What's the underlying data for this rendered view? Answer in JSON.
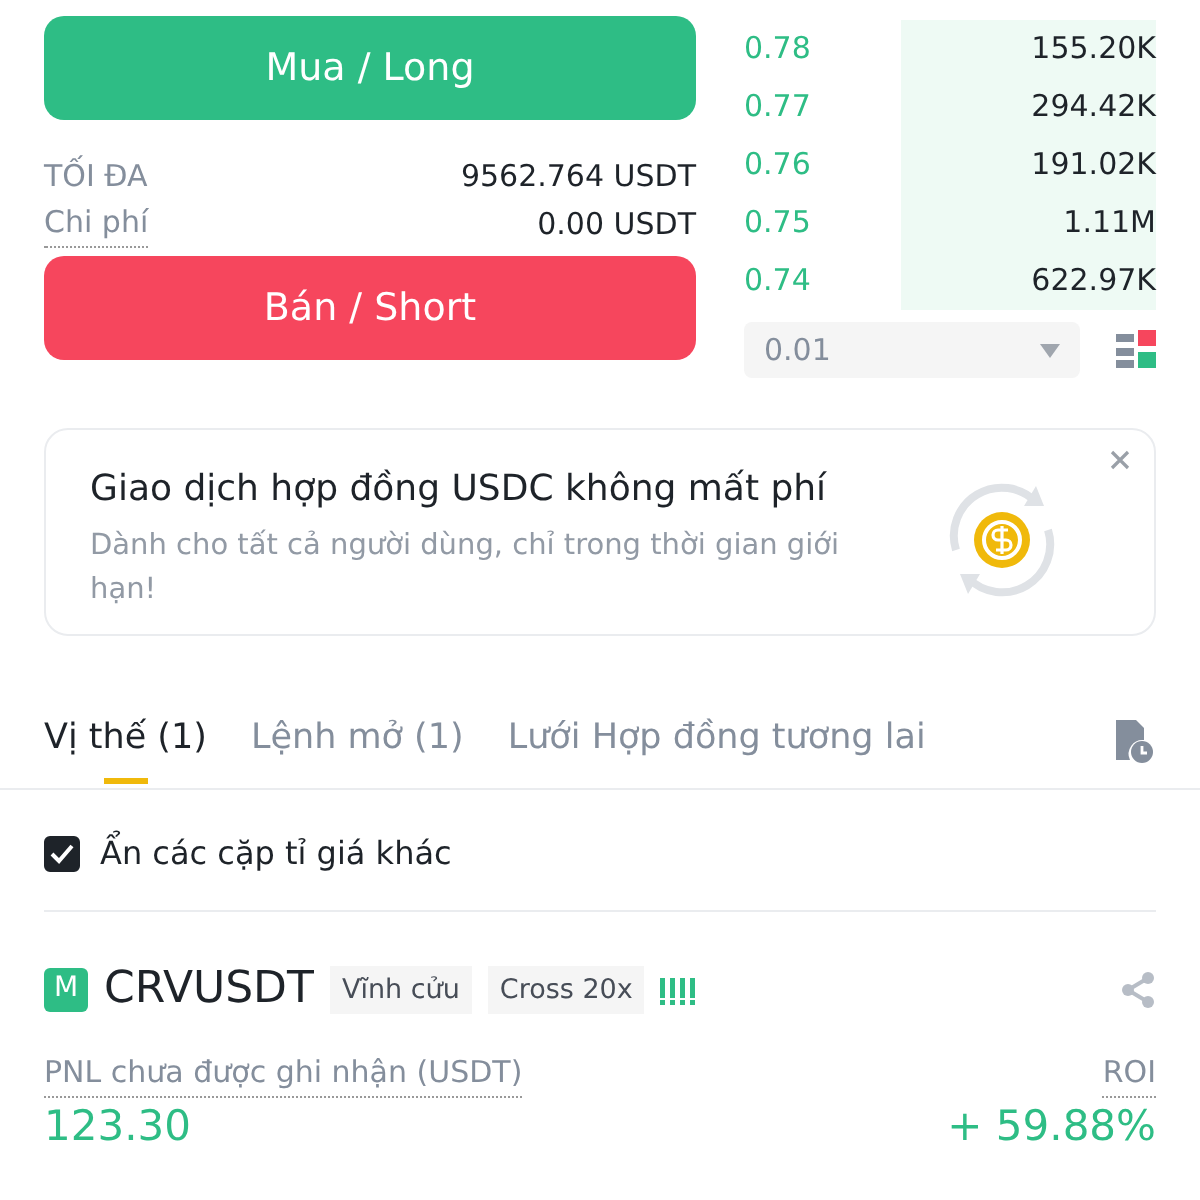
{
  "buy_button": "Mua / Long",
  "max_row": {
    "label": "TỐI ĐA",
    "value": "9562.764 USDT"
  },
  "cost_row": {
    "label": "Chi phí",
    "value": "0.00 USDT"
  },
  "sell_button": "Bán / Short",
  "order_book": [
    {
      "price": "0.78",
      "amount": "155.20K"
    },
    {
      "price": "0.77",
      "amount": "294.42K"
    },
    {
      "price": "0.76",
      "amount": "191.02K"
    },
    {
      "price": "0.75",
      "amount": "1.11M"
    },
    {
      "price": "0.74",
      "amount": "622.97K"
    }
  ],
  "precision_select": {
    "value": "0.01"
  },
  "promo": {
    "title": "Giao dịch hợp đồng USDC không mất phí",
    "text": "Dành cho tất cả người dùng, chỉ trong thời gian giới hạn!"
  },
  "tabs": [
    {
      "label": "Vị thế (1)",
      "selected": true
    },
    {
      "label": "Lệnh mở (1)",
      "selected": false
    },
    {
      "label": "Lưới Hợp đồng tương lai",
      "selected": false
    }
  ],
  "hide_pairs": {
    "label": "Ẩn các cặp tỉ giá khác",
    "checked": true
  },
  "position": {
    "badge": "M",
    "symbol": "CRVUSDT",
    "tags": [
      "Vĩnh cửu",
      "Cross 20x"
    ],
    "pnl_label": "PNL chưa được ghi nhận (USDT)",
    "roi_label": "ROI",
    "pnl": "123.30",
    "roi": "+ 59.88%"
  }
}
